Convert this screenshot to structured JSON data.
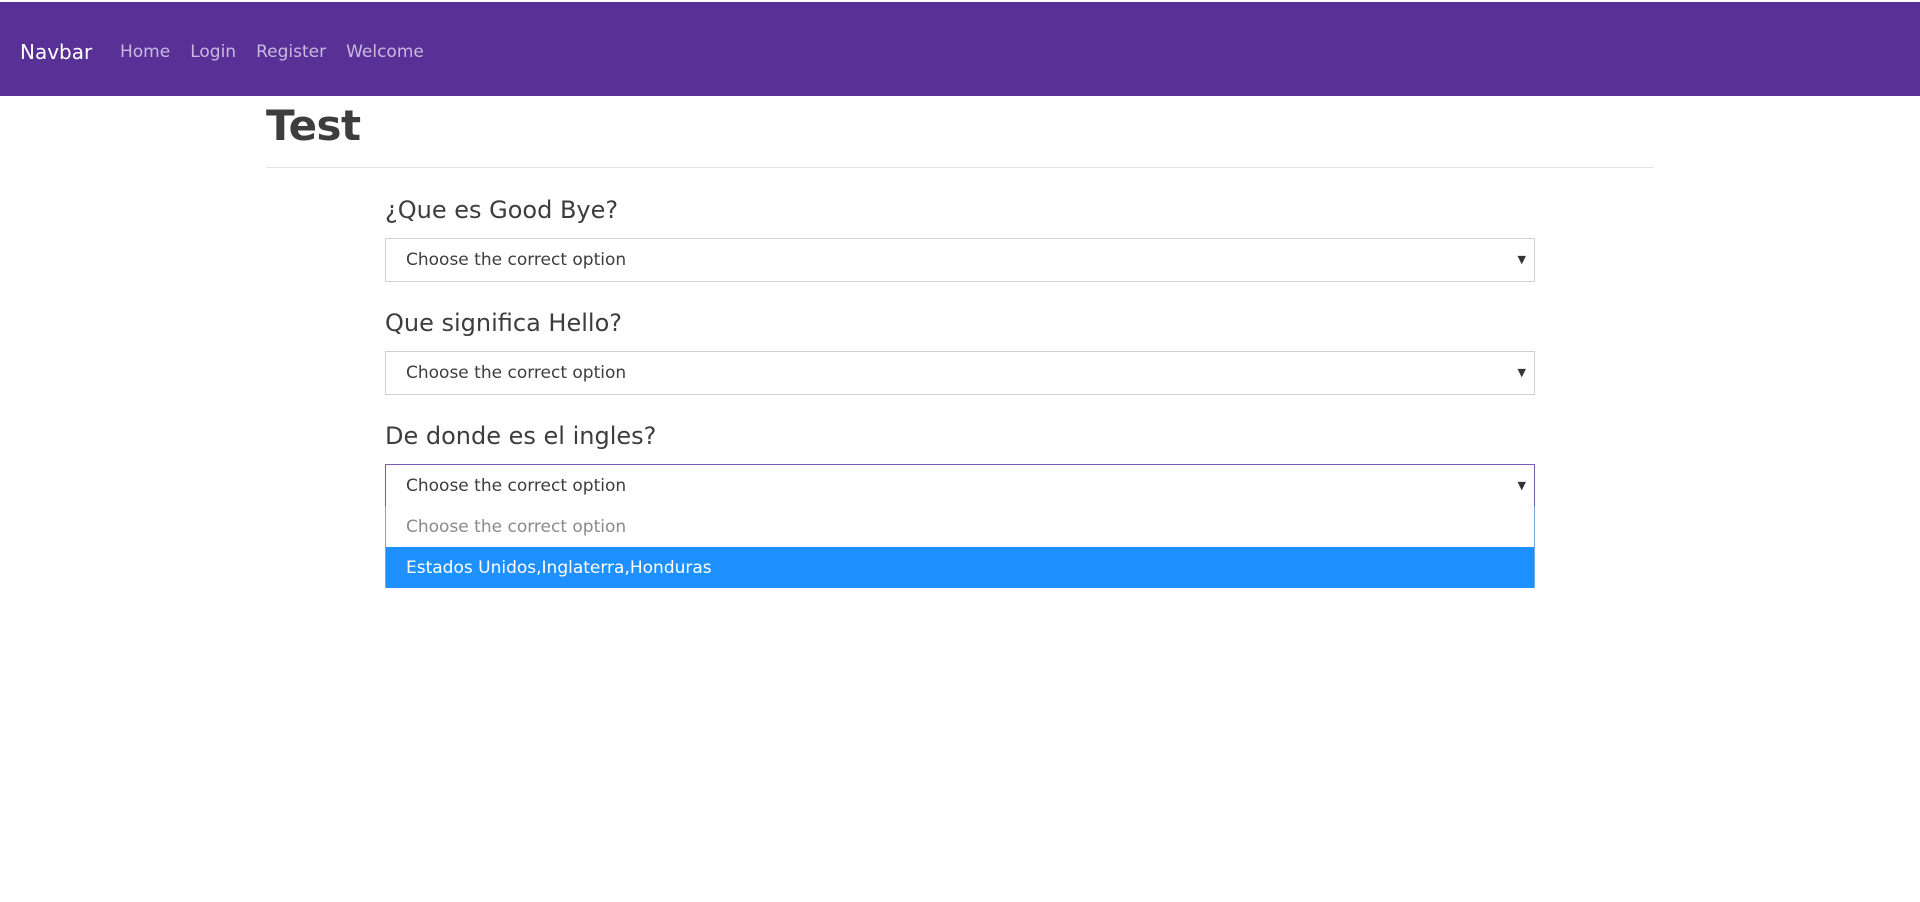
{
  "navbar": {
    "brand": "Navbar",
    "links": [
      "Home",
      "Login",
      "Register",
      "Welcome"
    ],
    "background": "#593196"
  },
  "page": {
    "title": "Test"
  },
  "questions": [
    {
      "label": "¿Que es Good Bye?",
      "selected": "Choose the correct option"
    },
    {
      "label": "Que significa Hello?",
      "selected": "Choose the correct option"
    },
    {
      "label": "De donde es el ingles?",
      "selected": "Choose the correct option"
    }
  ],
  "dropdown": {
    "options": [
      "Choose the correct option",
      "Estados Unidos,Inglaterra,Honduras"
    ],
    "highlight_color": "#1e90ff"
  }
}
